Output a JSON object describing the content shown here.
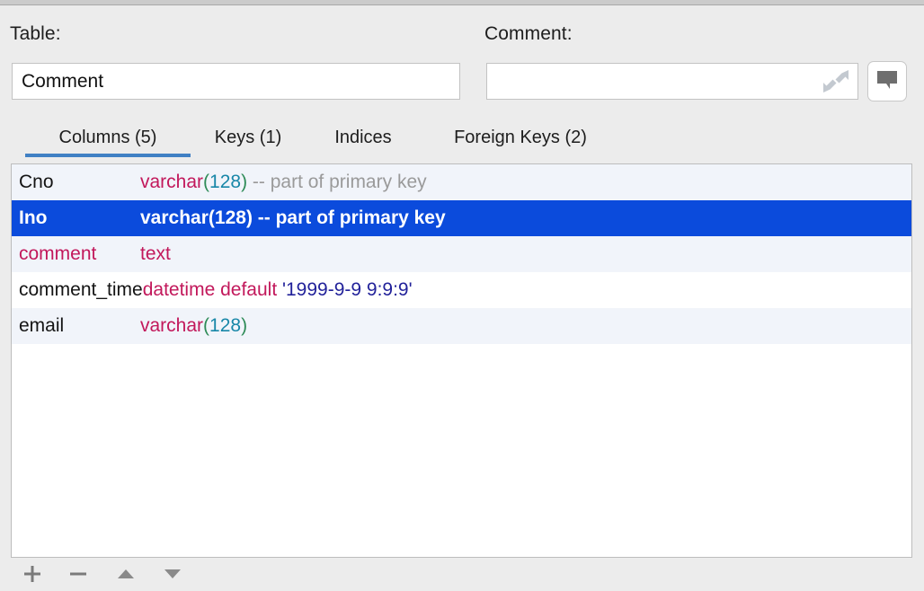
{
  "header": {
    "table_label": "Table:",
    "table_value": "Comment",
    "comment_label": "Comment:",
    "comment_value": "",
    "comment_placeholder": "",
    "expand_icon": "expand-diagonal-icon",
    "bubble_button_icon": "speech-bubble-icon"
  },
  "tabs": [
    {
      "label": "Columns (5)",
      "active": true
    },
    {
      "label": "Keys (1)",
      "active": false
    },
    {
      "label": "Indices",
      "active": false
    },
    {
      "label": "Foreign Keys (2)",
      "active": false
    }
  ],
  "columns": [
    {
      "name": "Cno",
      "name_style": "plain",
      "selected": false,
      "definition": [
        {
          "text": "varchar",
          "style": "type"
        },
        {
          "text": "(",
          "style": "paren"
        },
        {
          "text": "128",
          "style": "num"
        },
        {
          "text": ")",
          "style": "paren"
        },
        {
          "text": " -- part of primary key",
          "style": "comment"
        }
      ]
    },
    {
      "name": "Ino",
      "name_style": "plain",
      "selected": true,
      "definition": [
        {
          "text": "varchar",
          "style": "type"
        },
        {
          "text": "(",
          "style": "paren"
        },
        {
          "text": "128",
          "style": "num"
        },
        {
          "text": ")",
          "style": "paren"
        },
        {
          "text": " -- part of primary key",
          "style": "comment"
        }
      ]
    },
    {
      "name": "comment",
      "name_style": "kw",
      "selected": false,
      "definition": [
        {
          "text": "text",
          "style": "type"
        }
      ]
    },
    {
      "name": "comment_time",
      "name_style": "plain",
      "selected": false,
      "definition": [
        {
          "text": "datetime default ",
          "style": "type"
        },
        {
          "text": "'1999-9-9 9:9:9'",
          "style": "string"
        }
      ]
    },
    {
      "name": "email",
      "name_style": "plain",
      "selected": false,
      "definition": [
        {
          "text": "varchar",
          "style": "type"
        },
        {
          "text": "(",
          "style": "paren"
        },
        {
          "text": "128",
          "style": "num"
        },
        {
          "text": ")",
          "style": "paren"
        }
      ]
    }
  ],
  "toolbar": {
    "add_icon": "plus-icon",
    "remove_icon": "minus-icon",
    "move_up_icon": "triangle-up-icon",
    "move_down_icon": "triangle-down-icon"
  },
  "colors": {
    "selection_blue": "#0b4bdc",
    "tab_underline_blue": "#4080c4",
    "type_crimson": "#c2185b",
    "paren_green": "#2e8b57",
    "number_teal": "#1887a8",
    "comment_gray": "#9a9a9a",
    "string_navy": "#22229a",
    "window_bg": "#ececec",
    "row_stripe": "#f1f4fa"
  }
}
